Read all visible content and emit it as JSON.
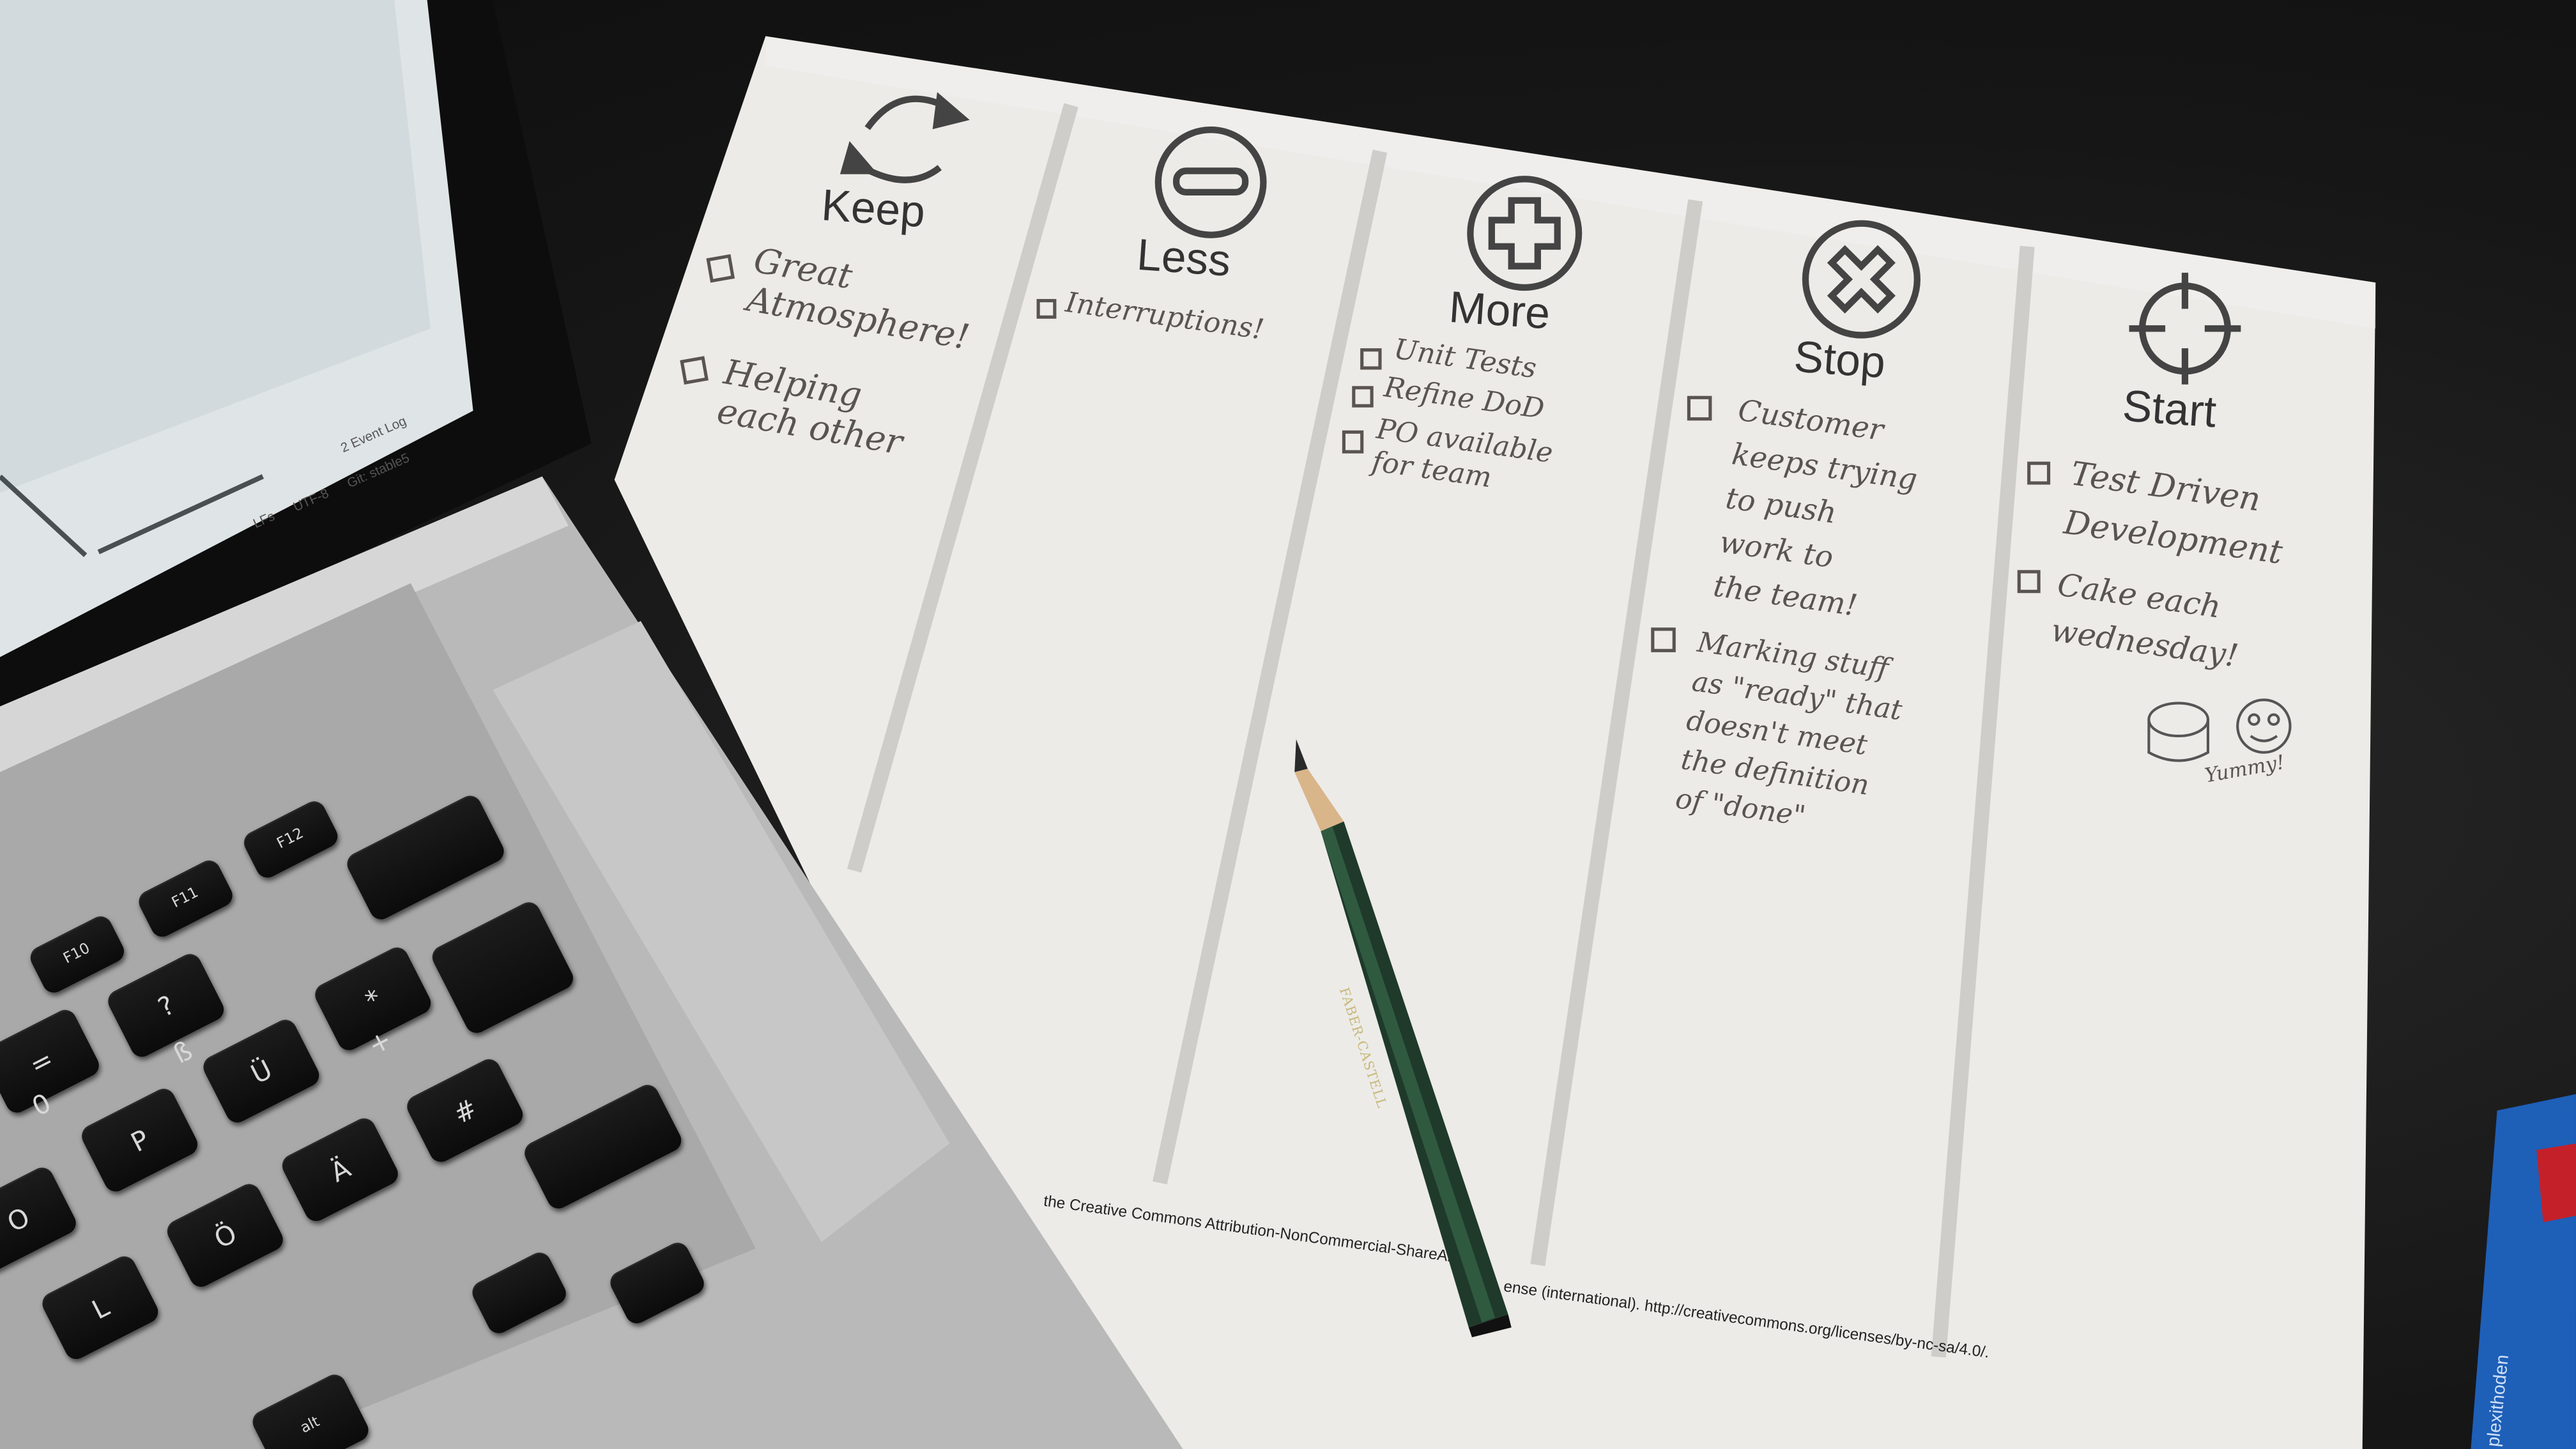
{
  "columns": [
    {
      "label": "Keep",
      "icon": "cycle-arrows-icon",
      "items": [
        "Great\nAtmosphere!",
        "Helping\neach other"
      ]
    },
    {
      "label": "Less",
      "icon": "minus-circle-icon",
      "items": [
        "Interruptions!"
      ]
    },
    {
      "label": "More",
      "icon": "plus-circle-icon",
      "items": [
        "Unit Tests",
        "Refine DoD",
        "PO available\nfor team"
      ]
    },
    {
      "label": "Stop",
      "icon": "x-circle-icon",
      "items": [
        "Customer\nkeeps trying\nto push\nwork to\nthe team!",
        "Marking stuff\nas \"ready\" that\ndoesn't meet\nthe definition\nof \"done\""
      ]
    },
    {
      "label": "Start",
      "icon": "crosshair-icon",
      "items": [
        "Test Driven\nDevelopment",
        "Cake each\nwednesday!"
      ]
    }
  ],
  "doodle_caption": "Yummy!",
  "license_text": "the Creative Commons Attribution-NonCommercial-ShareAlik",
  "license_text_2": "ense (international). http://creativecommons.org/licenses/by-nc-sa/4.0/.",
  "laptop": {
    "status_lfs": "LFs",
    "status_encoding": "UTF-8",
    "status_git": "Git: stable5",
    "status_event_log": "2 Event Log",
    "keys": [
      "F10",
      "F11",
      "F12",
      "?",
      "ß",
      "=",
      "0",
      "P",
      "Ü",
      "*",
      "+",
      "#",
      "Ä",
      "Ö",
      "L",
      "O",
      "alt"
    ]
  },
  "pencil_brand": "FABER-CASTELL",
  "book_spine": "plexithoden"
}
